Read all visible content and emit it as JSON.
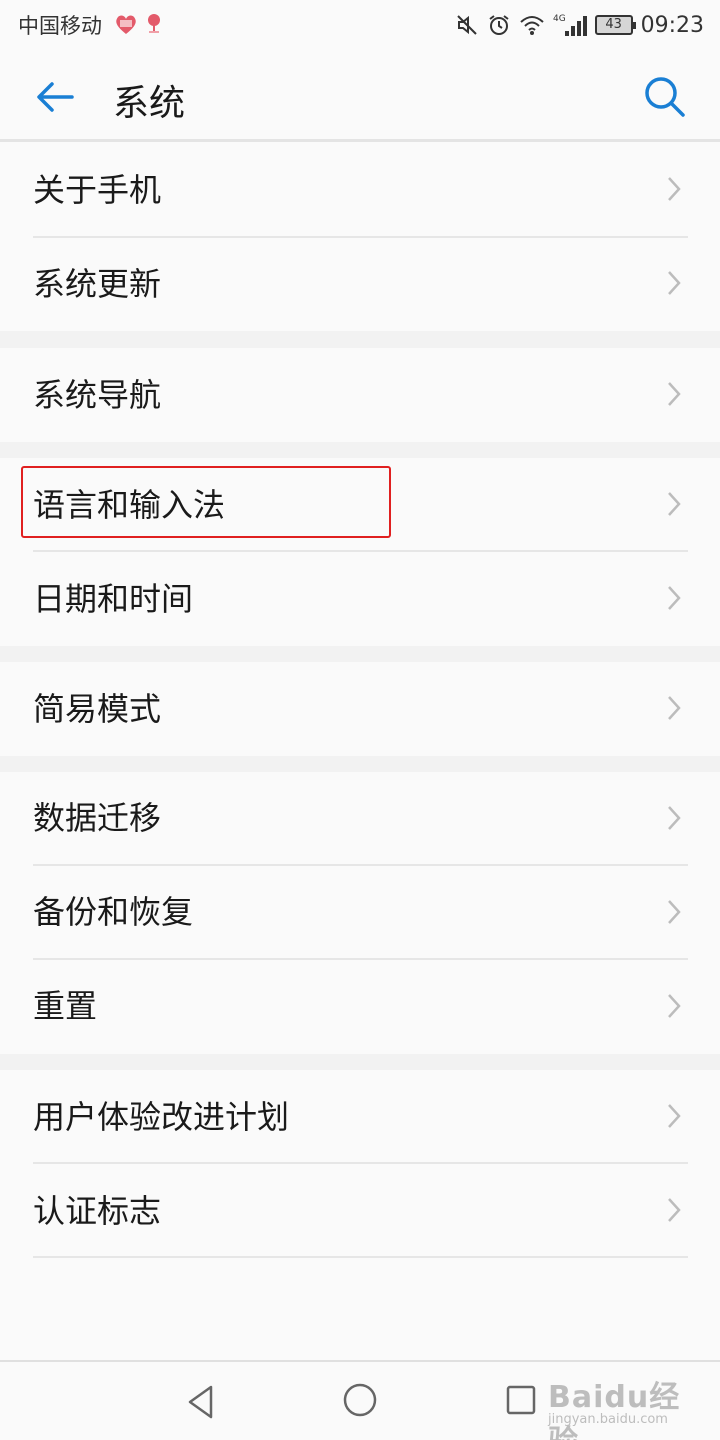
{
  "status_bar": {
    "carrier": "中国移动",
    "time": "09:23",
    "battery": "43",
    "network": "4G"
  },
  "header": {
    "title": "系统"
  },
  "menu": {
    "groups": [
      {
        "items": [
          {
            "label": "关于手机"
          },
          {
            "label": "系统更新"
          }
        ]
      },
      {
        "items": [
          {
            "label": "系统导航"
          }
        ]
      },
      {
        "items": [
          {
            "label": "语言和输入法"
          },
          {
            "label": "日期和时间"
          }
        ]
      },
      {
        "items": [
          {
            "label": "简易模式"
          }
        ]
      },
      {
        "items": [
          {
            "label": "数据迁移"
          },
          {
            "label": "备份和恢复"
          },
          {
            "label": "重置"
          }
        ]
      },
      {
        "items": [
          {
            "label": "用户体验改进计划"
          },
          {
            "label": "认证标志"
          }
        ]
      }
    ]
  },
  "watermark": {
    "main": "Baidu经验",
    "sub": "jingyan.baidu.com"
  },
  "colors": {
    "accent": "#1a7fd4",
    "highlight": "#e02020",
    "background": "#f2f2f2",
    "surface": "#fafafa"
  },
  "icons": {
    "back": "arrow-left-icon",
    "search": "search-icon",
    "chevron": "chevron-right-icon",
    "nav_back": "triangle-back-icon",
    "nav_home": "circle-home-icon",
    "nav_recent": "square-recent-icon"
  }
}
